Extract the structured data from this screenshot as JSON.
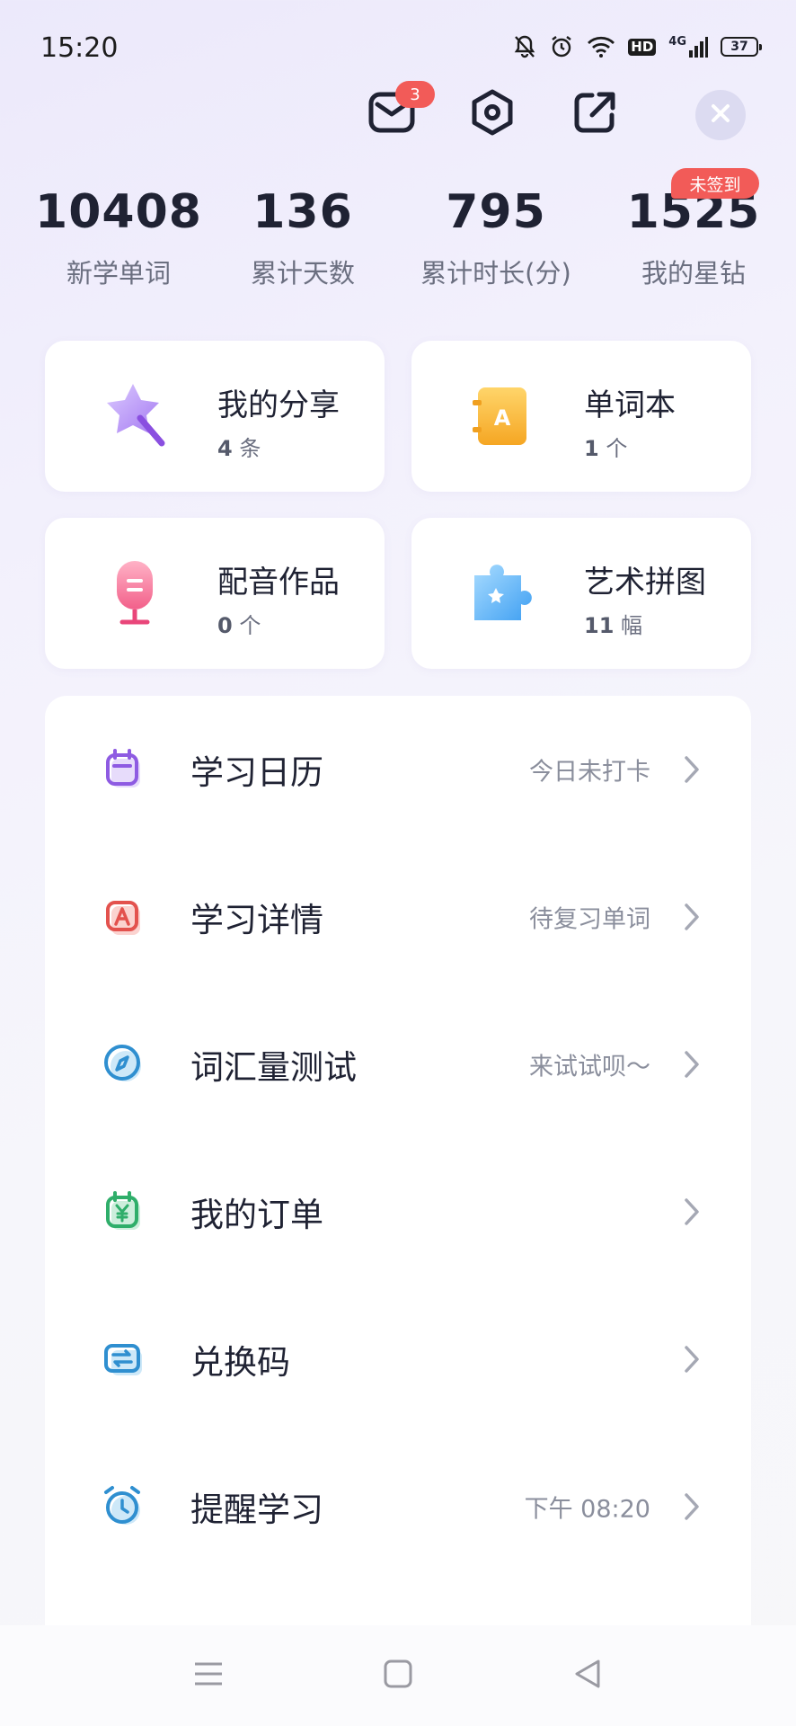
{
  "status_bar": {
    "time": "15:20",
    "network": "4G",
    "hd": "HD",
    "battery": "37",
    "icons": [
      "bell-off-icon",
      "alarm-icon",
      "wifi-icon",
      "hd-icon",
      "signal-icon",
      "battery-icon"
    ]
  },
  "top_actions": {
    "message_badge": "3",
    "icons": [
      "mail-icon",
      "settings-icon",
      "share-icon",
      "close-icon"
    ]
  },
  "stats": [
    {
      "value": "10408",
      "label": "新学单词"
    },
    {
      "value": "136",
      "label": "累计天数"
    },
    {
      "value": "795",
      "label": "累计时长(分)"
    },
    {
      "value": "1525",
      "label": "我的星钻"
    }
  ],
  "signin_badge": "未签到",
  "cards": [
    {
      "title": "我的分享",
      "count": "4",
      "unit": "条",
      "icon": "star-wand-icon"
    },
    {
      "title": "单词本",
      "count": "1",
      "unit": "个",
      "icon": "wordbook-icon"
    },
    {
      "title": "配音作品",
      "count": "0",
      "unit": "个",
      "icon": "microphone-icon"
    },
    {
      "title": "艺术拼图",
      "count": "11",
      "unit": "幅",
      "icon": "puzzle-icon"
    }
  ],
  "menu": [
    {
      "label": "学习日历",
      "hint": "今日未打卡",
      "icon": "calendar-icon"
    },
    {
      "label": "学习详情",
      "hint": "待复习单词",
      "icon": "study-detail-icon"
    },
    {
      "label": "词汇量测试",
      "hint": "来试试呗～",
      "icon": "compass-icon"
    },
    {
      "label": "我的订单",
      "hint": "",
      "icon": "order-icon"
    },
    {
      "label": "兑换码",
      "hint": "",
      "icon": "redeem-icon"
    },
    {
      "label": "提醒学习",
      "hint": "下午 08:20",
      "icon": "alarm-clock-icon"
    }
  ],
  "nav_bar": {
    "icons": [
      "menu-nav-icon",
      "home-nav-icon",
      "back-nav-icon"
    ]
  },
  "colors": {
    "accent_red": "#f25b58",
    "text_primary": "#1f2233",
    "text_secondary": "#6b6f80"
  }
}
